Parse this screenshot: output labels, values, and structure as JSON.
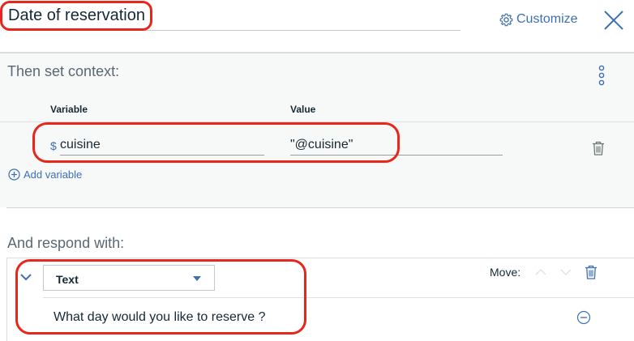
{
  "header": {
    "node_title": "Date of reservation",
    "customize_label": "Customize"
  },
  "context": {
    "section_title": "Then set context:",
    "columns": {
      "variable": "Variable",
      "value": "Value"
    },
    "rows": [
      {
        "prefix": "$",
        "variable": "cuisine",
        "value": "\"@cuisine\""
      }
    ],
    "add_variable_label": "Add variable"
  },
  "respond": {
    "section_title": "And respond with:",
    "response_type": "Text",
    "move_label": "Move:",
    "response_text": "What day would you like to reserve ?"
  },
  "colors": {
    "accent": "#3d70b2",
    "highlight": "#e8261b",
    "text": "#152935",
    "muted": "#5a6872"
  },
  "icons": [
    "gear-icon",
    "close-icon",
    "overflow-menu-icon",
    "trash-icon",
    "add-circle-icon",
    "chevron-down-icon",
    "caret-down-icon",
    "arrow-up-icon",
    "arrow-down-icon",
    "remove-circle-icon"
  ]
}
